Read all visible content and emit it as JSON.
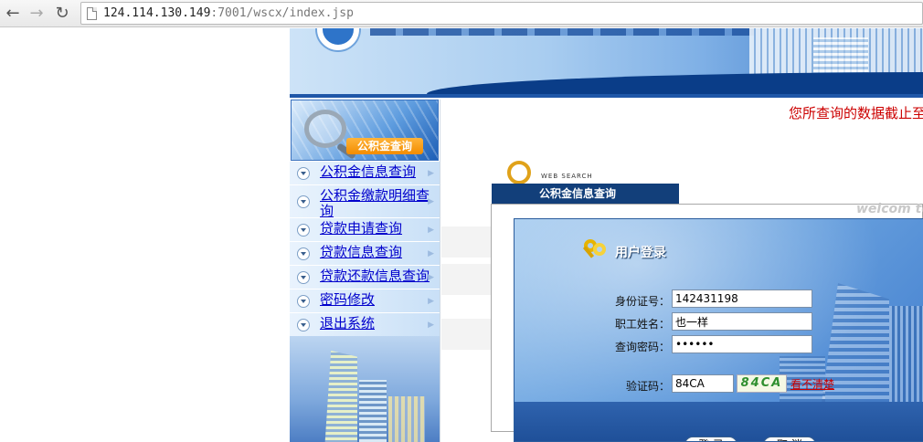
{
  "browser": {
    "back_icon": "back-arrow-icon",
    "forward_icon": "forward-arrow-icon",
    "reload_icon": "reload-icon",
    "url_host": "124.114.130.149",
    "url_rest": ":7001/wscx/index.jsp"
  },
  "sidebar": {
    "header_label": "公积金查询",
    "items": [
      {
        "label": "公积金信息查询"
      },
      {
        "label": "公积金缴款明细查询"
      },
      {
        "label": "贷款申请查询"
      },
      {
        "label": "贷款信息查询"
      },
      {
        "label": "贷款还款信息查询"
      },
      {
        "label": "密码修改"
      },
      {
        "label": "退出系统"
      }
    ]
  },
  "main": {
    "notice": "您所查询的数据截止至",
    "web_search": "WEB SEARCH",
    "panel_title": "公积金信息查询",
    "welcome": "welcom to"
  },
  "login": {
    "title": "用户登录",
    "id_label": "身份证号：",
    "id_value": "142431198",
    "name_label": "职工姓名：",
    "name_value": "也一样",
    "password_label": "查询密码：",
    "password_value": "••••••",
    "captcha_label": "验证码：",
    "captcha_value": "84CA",
    "captcha_image_text": "84CA",
    "cant_see": "看不清楚",
    "login_button": "登 录",
    "cancel_button": "取 消"
  },
  "colors": {
    "accent": "#123f7a",
    "link": "#0000cc",
    "notice": "#cc0000"
  }
}
